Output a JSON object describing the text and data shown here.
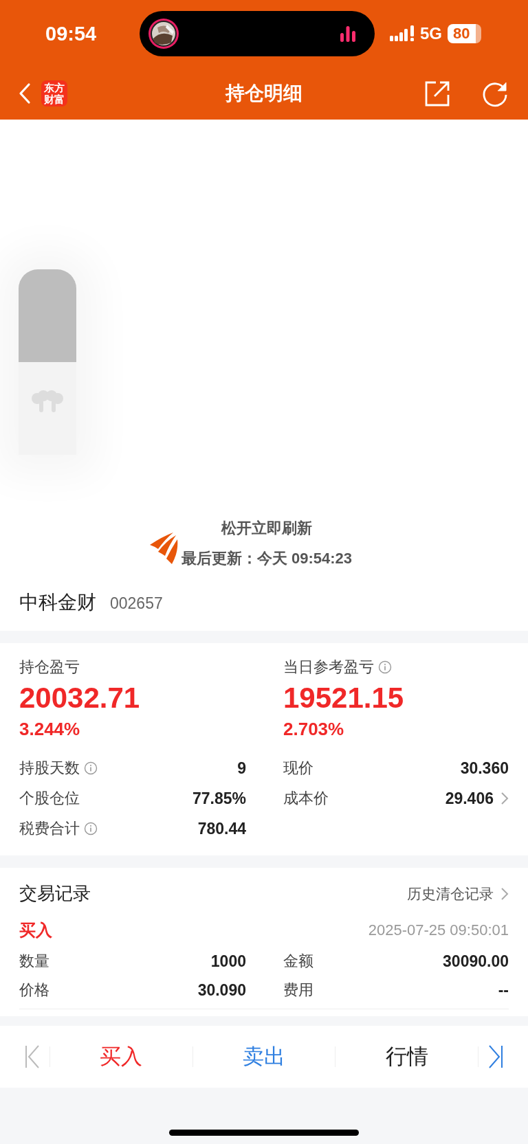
{
  "status_bar": {
    "time": "09:54",
    "network": "5G",
    "battery": "80"
  },
  "header": {
    "logo_lines": [
      "东方",
      "财富"
    ],
    "title": "持仓明细"
  },
  "volume_overlay": {
    "level": 0.5
  },
  "refresh": {
    "status": "松开立即刷新",
    "last_update": "最后更新：今天 09:54:23"
  },
  "stock": {
    "name": "中科金财",
    "code": "002657"
  },
  "summary": [
    {
      "label": "持仓盈亏",
      "info": false,
      "value": "20032.71",
      "percent": "3.244%"
    },
    {
      "label": "当日参考盈亏",
      "info": true,
      "value": "19521.15",
      "percent": "2.703%"
    }
  ],
  "stats": [
    {
      "cells": [
        {
          "label": "持股天数",
          "info": true,
          "value": "9",
          "chevron": false
        },
        {
          "label": "现价",
          "info": false,
          "value": "30.360",
          "chevron": false
        }
      ]
    },
    {
      "cells": [
        {
          "label": "个股仓位",
          "info": false,
          "value": "77.85%",
          "chevron": false
        },
        {
          "label": "成本价",
          "info": false,
          "value": "29.406",
          "chevron": true
        }
      ]
    },
    {
      "cells": [
        {
          "label": "税费合计",
          "info": true,
          "value": "780.44",
          "chevron": false
        }
      ]
    }
  ],
  "trades": {
    "title": "交易记录",
    "history_link": "历史清仓记录",
    "records": [
      {
        "kind": "buy",
        "side": "买入",
        "time": "2025-07-25 09:50:01",
        "fields": [
          {
            "label": "数量",
            "value": "1000"
          },
          {
            "label": "金额",
            "value": "30090.00"
          },
          {
            "label": "价格",
            "value": "30.090"
          },
          {
            "label": "费用",
            "value": "--"
          }
        ]
      }
    ]
  },
  "bottom_bar": [
    {
      "kind": "first"
    },
    {
      "kind": "action",
      "label": "买入",
      "color": "#f02828"
    },
    {
      "kind": "action",
      "label": "卖出",
      "color": "#2f7fe0"
    },
    {
      "kind": "action",
      "label": "行情",
      "color": "#222222"
    },
    {
      "kind": "last"
    }
  ]
}
